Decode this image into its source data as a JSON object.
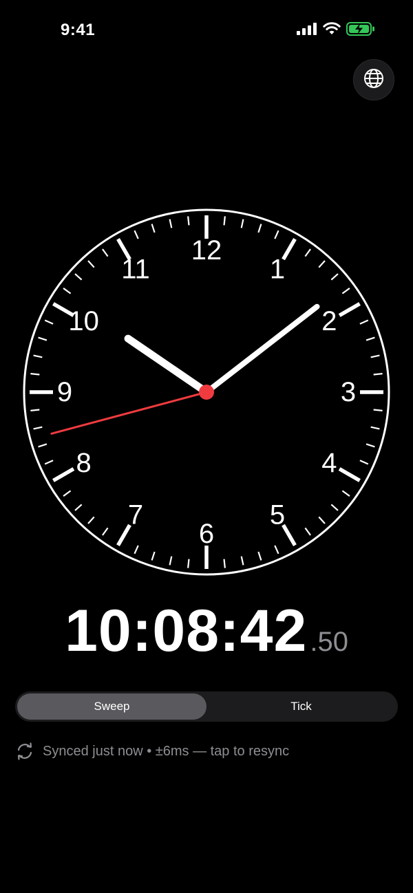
{
  "status_bar": {
    "time": "9:41",
    "icons": [
      "cellular-signal-icon",
      "wifi-icon",
      "battery-charging-icon"
    ],
    "battery_color": "#34c759"
  },
  "toolbar": {
    "globe_icon": "globe-icon"
  },
  "clock": {
    "numerals": [
      "12",
      "1",
      "2",
      "3",
      "4",
      "5",
      "6",
      "7",
      "8",
      "9",
      "10",
      "11"
    ],
    "time": {
      "hours": 10,
      "minutes": 8,
      "seconds": 42.5
    },
    "face_color": "#000000",
    "hand_color": "#ffffff",
    "second_hand_color": "#ef3b3f"
  },
  "digital": {
    "main": "10:08:42",
    "fraction": ".50"
  },
  "mode_toggle": {
    "options": [
      "Sweep",
      "Tick"
    ],
    "selected": "Sweep"
  },
  "sync": {
    "icon": "sync-icon",
    "text": "Synced just now • ±6ms — tap to resync"
  }
}
